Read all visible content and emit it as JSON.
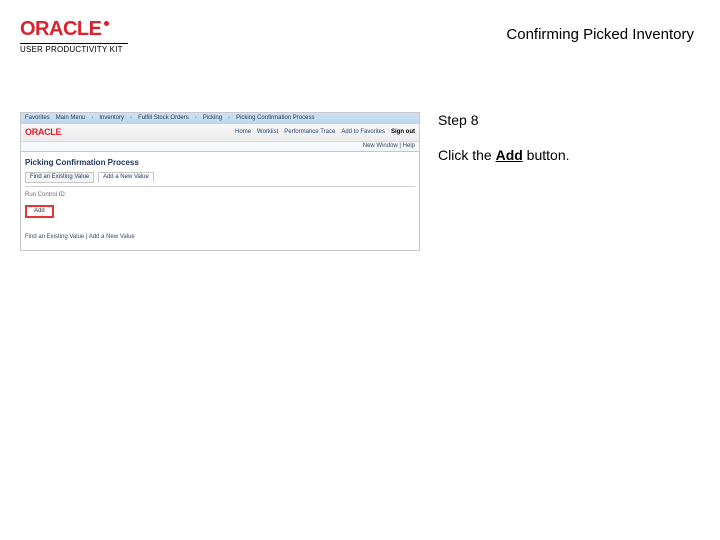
{
  "brand": {
    "logo_text": "ORACLE",
    "subtitle": "USER PRODUCTIVITY KIT"
  },
  "doc": {
    "title": "Confirming Picked Inventory"
  },
  "step": {
    "label": "Step 8",
    "instruction_prefix": "Click the ",
    "instruction_strong": "Add",
    "instruction_suffix": " button."
  },
  "mini": {
    "breadcrumb": [
      "Favorites",
      "Main Menu",
      "Inventory",
      "Fulfill Stock Orders",
      "Picking",
      "Picking Confirmation Process"
    ],
    "logo": "ORACLE",
    "toolbar": {
      "home": "Home",
      "worklist": "Worklist",
      "performance": "Performance Trace",
      "addto": "Add to Favorites",
      "signout": "Sign out"
    },
    "status_line": "New Window | Help",
    "page_title": "Picking Confirmation Process",
    "tabs": {
      "find": "Find an Existing Value",
      "add": "Add a New Value"
    },
    "runctl_label": "Run Control ID:",
    "add_button": "Add",
    "footer_links": "Find an Existing Value | Add a New Value"
  }
}
